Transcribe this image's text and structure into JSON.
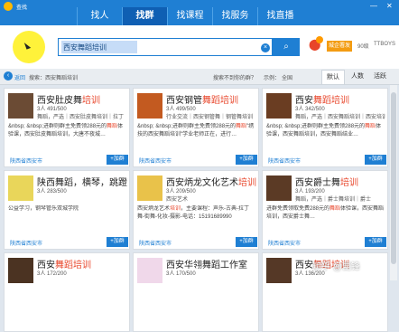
{
  "app": {
    "title": "查找"
  },
  "nav": {
    "tabs": [
      "找人",
      "找群",
      "找课程",
      "找服务",
      "找直播"
    ],
    "active": 1
  },
  "window": {
    "min": "—",
    "close": "✕"
  },
  "search": {
    "value": "西安舞蹈培训",
    "clear": "×",
    "button_icon": "⌕"
  },
  "account": {
    "location_badge": "城企署发",
    "level": "90级",
    "user": "TTBOYS"
  },
  "filters": {
    "back": "‹",
    "back_label": "返回",
    "category": "搜索：西安舞蹈培训",
    "prompt": "搜索不到你的群？",
    "region_label": "示例：",
    "region_value": "全国",
    "sort": [
      "默认",
      "人数",
      "活跃"
    ],
    "sort_active": 0
  },
  "cards": [
    {
      "name_pre": "西安肚皮舞",
      "name_hl": "培训",
      "score": "3人 491/500",
      "line1": "舞蹈，严选｜西安肚皮舞培训｜拉丁",
      "desc_pre": "&nbsp; &nbsp;进群则群主免费领288元的",
      "desc_hl": "舞蹈",
      "desc_post": "体验课，西安肚皮舞蹈培训，大唐不夜城…",
      "loc": "陕西省西安市",
      "btn": "+加群"
    },
    {
      "name_pre": "西安钢管",
      "name_hl": "舞蹈培训",
      "score": "3人 499/500",
      "line1": "行业交流｜西安钢管舞｜钢管舞培训",
      "desc_pre": "&nbsp; &nbsp;进群则群主免费领288元的",
      "desc_hl": "舞蹈",
      "desc_post": "\"绣技的西安舞蹈培训\"学业老师正在，进行…",
      "loc": "陕西省西安市",
      "btn": "+加群"
    },
    {
      "name_pre": "西安",
      "name_hl": "舞蹈培训",
      "score": "3人 342/500",
      "line1": "舞蹈，严选｜西安舞蹈培训｜西安培训",
      "desc_pre": "&nbsp; &nbsp;进群则群主免费领288元的",
      "desc_hl": "舞蹈",
      "desc_post": "体验课，西安舞蹈培训，西安舞蹈结业…",
      "loc": "陕西省西安市",
      "btn": "+加群"
    },
    {
      "name_pre": "陕西舞蹈，",
      "name_hl": "",
      "name_post": "横琴，跳蹬",
      "score": "3人 283/500",
      "line1": "",
      "desc_pre": "公益学习，钢琴管乐双城学院",
      "desc_hl": "",
      "desc_post": "",
      "loc": "陕西省西安市",
      "btn": "+加群"
    },
    {
      "name_pre": "西安炳龙文化艺术",
      "name_hl": "培训",
      "score": "3人 209/500",
      "line1": "西安艺术",
      "desc_pre": "西安炳龙艺术",
      "desc_hl": "培训",
      "desc_post": "，主要课程：声乐-古典-拉丁舞-街舞-化妆-摄影-电话：15191689990",
      "loc": "陕西省西安市",
      "btn": "+加群"
    },
    {
      "name_pre": "西安爵士舞",
      "name_hl": "培训",
      "score": "3人 193/200",
      "line1": "舞蹈，严选｜爵士舞培训｜爵士",
      "desc_pre": "进群免费领取免费288元的",
      "desc_hl": "舞蹈",
      "desc_post": "体验课，西安舞蹈培训，西安爵士舞…",
      "loc": "陕西省西安市",
      "btn": "+加群"
    },
    {
      "name_pre": "西安",
      "name_hl": "舞蹈培训",
      "score": "3人 172/200",
      "line1": "",
      "desc_pre": "",
      "desc_hl": "",
      "desc_post": "",
      "loc": "",
      "btn": ""
    },
    {
      "name_pre": "西安华翎舞蹈工作室",
      "name_hl": "",
      "score": "3人 170/500",
      "line1": "",
      "desc_pre": "",
      "desc_hl": "",
      "desc_post": "",
      "loc": "",
      "btn": ""
    },
    {
      "name_pre": "西安",
      "name_hl": "舞蹈培训",
      "score": "3人 136/200",
      "line1": "",
      "desc_pre": "",
      "desc_hl": "",
      "desc_post": "",
      "loc": "",
      "btn": ""
    }
  ],
  "watermark": "知乎 @昆锋"
}
